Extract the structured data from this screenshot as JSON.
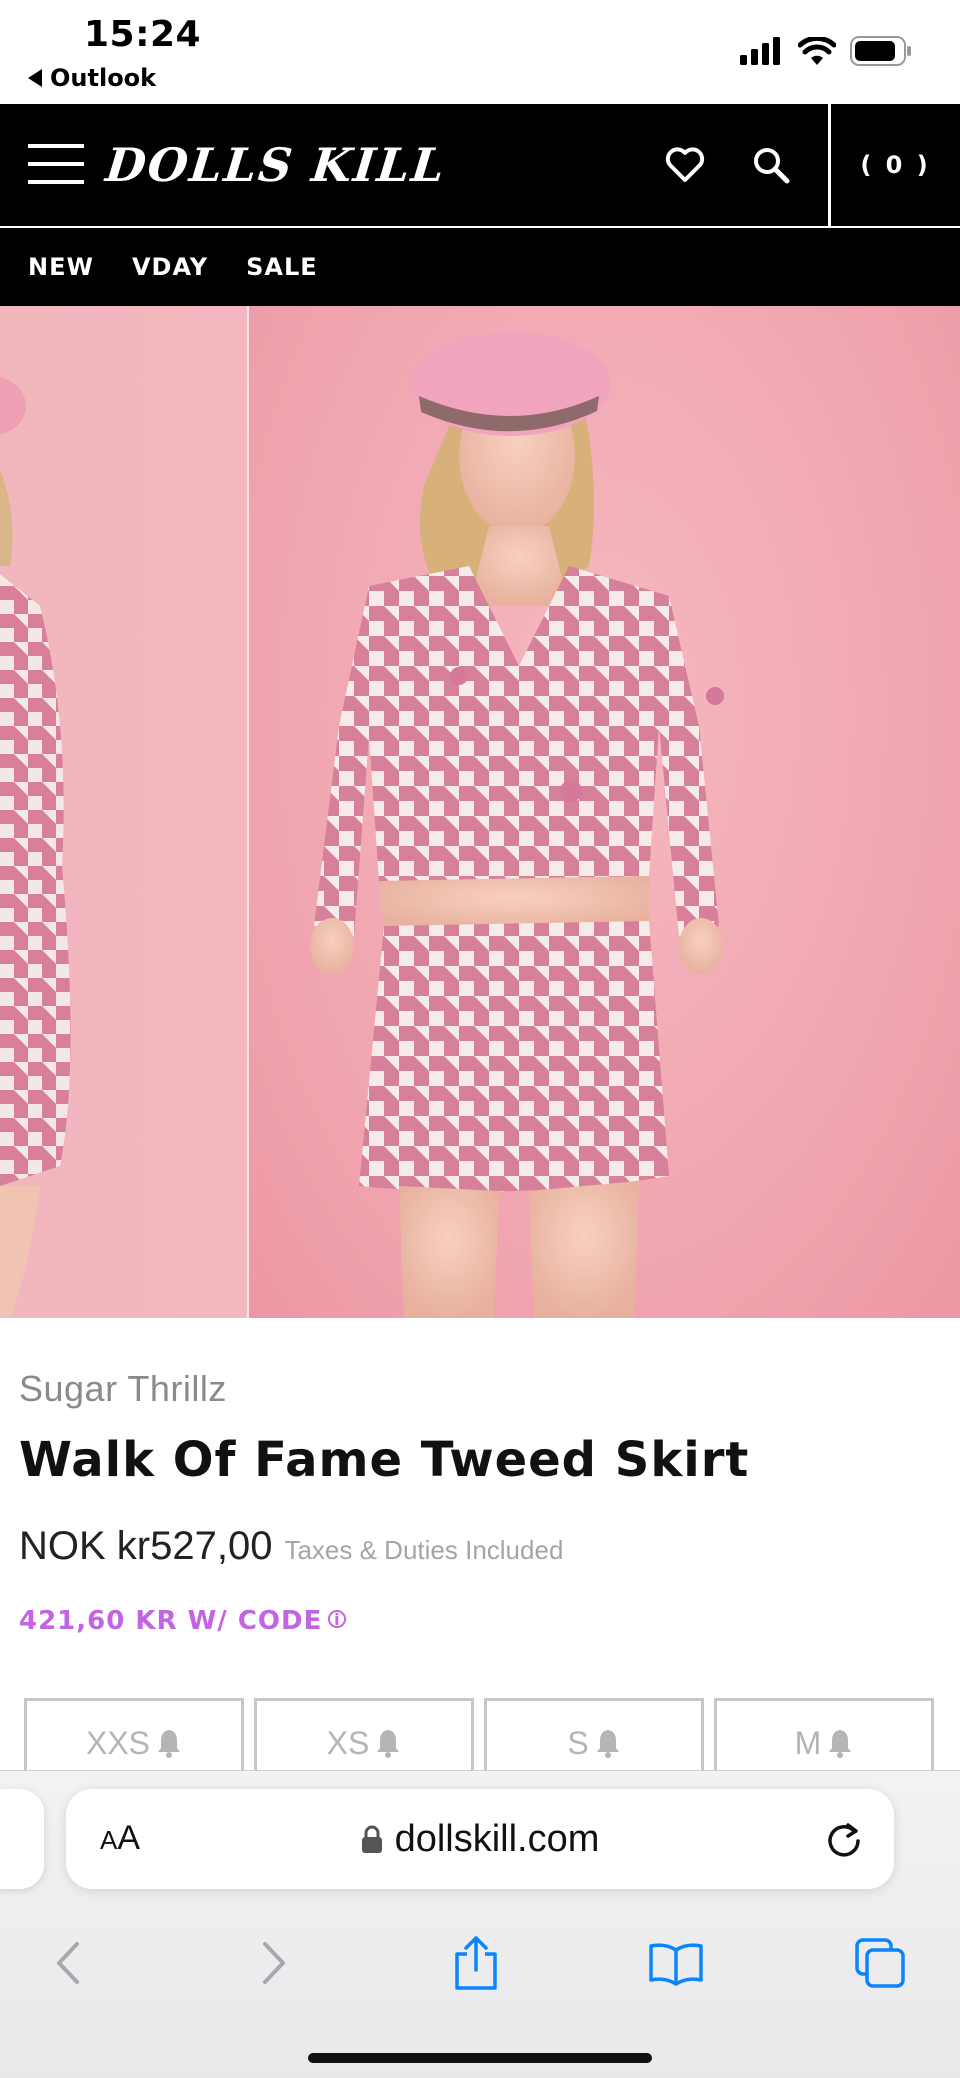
{
  "status_bar": {
    "time": "15:24",
    "back_app": "Outlook"
  },
  "header": {
    "logo": "DOLLS KILL",
    "cart_label": "( 0 )"
  },
  "nav": {
    "items": [
      "NEW",
      "VDAY",
      "SALE"
    ]
  },
  "product": {
    "brand": "Sugar Thrillz",
    "title": "Walk Of Fame Tweed Skirt",
    "price": "NOK kr527,00",
    "tax_note": "Taxes & Duties Included",
    "promo": "421,60 KR W/ CODE",
    "promo_info_glyph": "i",
    "sizes": [
      "XXS",
      "XS",
      "S",
      "M"
    ]
  },
  "browser": {
    "aa_label_big": "A",
    "aa_label_small": "A",
    "url": "dollskill.com"
  },
  "colors": {
    "promo": "#c364e2",
    "background_pink": "#f0a9b3",
    "accent_ios_blue": "#0a84ff"
  },
  "icons": [
    "wishlist-heart-icon",
    "search-icon",
    "lock-icon",
    "reload-icon",
    "back-icon",
    "forward-icon",
    "share-icon",
    "bookmarks-icon",
    "tabs-icon",
    "bell-icon"
  ]
}
